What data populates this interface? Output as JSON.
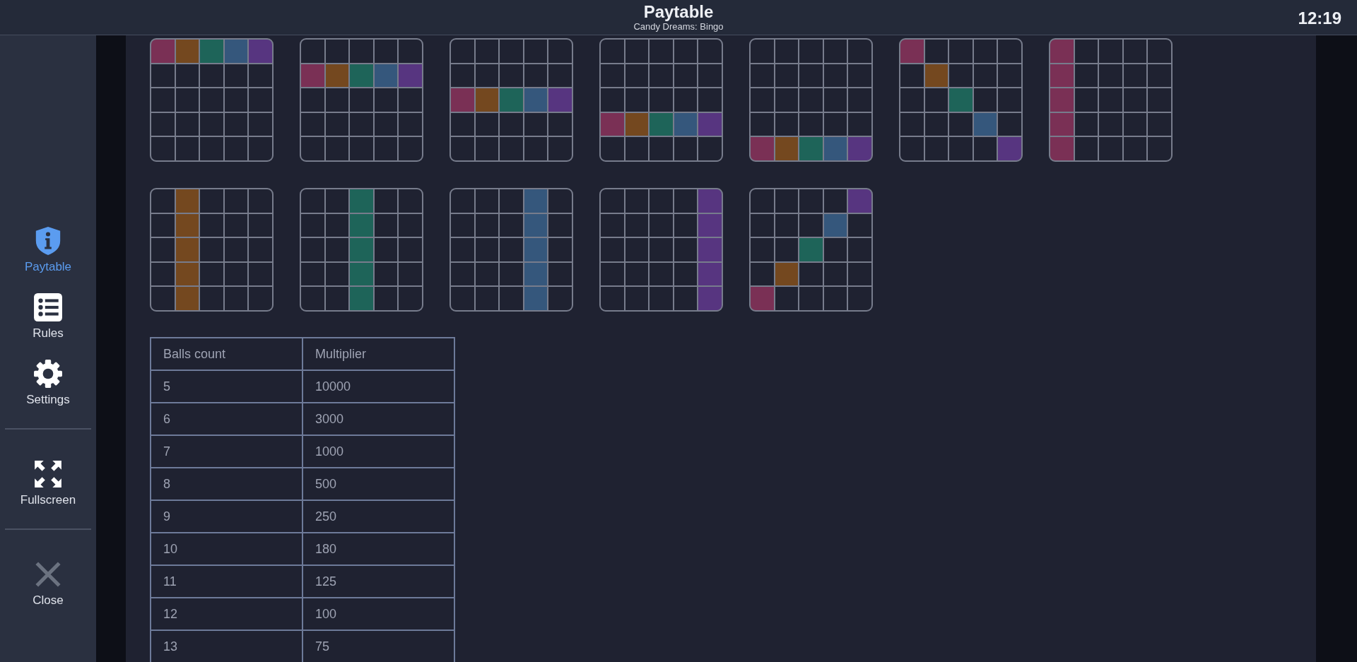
{
  "header": {
    "title": "Paytable",
    "subtitle": "Candy Dreams: Bingo",
    "clock": "12:19"
  },
  "sidebar": {
    "groups": [
      [
        {
          "label": "Paytable",
          "kind": "info",
          "selected": true
        },
        {
          "label": "Rules",
          "kind": "list",
          "selected": false
        },
        {
          "label": "Settings",
          "kind": "gear",
          "selected": false
        }
      ],
      [
        {
          "label": "Fullscreen",
          "kind": "fullscreen",
          "selected": false
        }
      ],
      [
        {
          "label": "Close",
          "kind": "close",
          "selected": false
        }
      ]
    ]
  },
  "line_colors": [
    {
      "color": "#7a3055"
    },
    {
      "color": "#74481f"
    },
    {
      "color": "#1e6459"
    },
    {
      "color": "#35577c"
    },
    {
      "color": "#573580"
    }
  ],
  "patterns": [
    {
      "rows": [
        [
          true,
          true,
          true,
          true,
          true
        ],
        [
          false,
          false,
          false,
          false,
          false
        ],
        [
          false,
          false,
          false,
          false,
          false
        ],
        [
          false,
          false,
          false,
          false,
          false
        ],
        [
          false,
          false,
          false,
          false,
          false
        ]
      ]
    },
    {
      "rows": [
        [
          false,
          false,
          false,
          false,
          false
        ],
        [
          true,
          true,
          true,
          true,
          true
        ],
        [
          false,
          false,
          false,
          false,
          false
        ],
        [
          false,
          false,
          false,
          false,
          false
        ],
        [
          false,
          false,
          false,
          false,
          false
        ]
      ]
    },
    {
      "rows": [
        [
          false,
          false,
          false,
          false,
          false
        ],
        [
          false,
          false,
          false,
          false,
          false
        ],
        [
          true,
          true,
          true,
          true,
          true
        ],
        [
          false,
          false,
          false,
          false,
          false
        ],
        [
          false,
          false,
          false,
          false,
          false
        ]
      ]
    },
    {
      "rows": [
        [
          false,
          false,
          false,
          false,
          false
        ],
        [
          false,
          false,
          false,
          false,
          false
        ],
        [
          false,
          false,
          false,
          false,
          false
        ],
        [
          true,
          true,
          true,
          true,
          true
        ],
        [
          false,
          false,
          false,
          false,
          false
        ]
      ]
    },
    {
      "rows": [
        [
          false,
          false,
          false,
          false,
          false
        ],
        [
          false,
          false,
          false,
          false,
          false
        ],
        [
          false,
          false,
          false,
          false,
          false
        ],
        [
          false,
          false,
          false,
          false,
          false
        ],
        [
          true,
          true,
          true,
          true,
          true
        ]
      ]
    },
    {
      "rows": [
        [
          true,
          false,
          false,
          false,
          false
        ],
        [
          false,
          true,
          false,
          false,
          false
        ],
        [
          false,
          false,
          true,
          false,
          false
        ],
        [
          false,
          false,
          false,
          true,
          false
        ],
        [
          false,
          false,
          false,
          false,
          true
        ]
      ]
    },
    {
      "rows": [
        [
          true,
          false,
          false,
          false,
          false
        ],
        [
          true,
          false,
          false,
          false,
          false
        ],
        [
          true,
          false,
          false,
          false,
          false
        ],
        [
          true,
          false,
          false,
          false,
          false
        ],
        [
          true,
          false,
          false,
          false,
          false
        ]
      ]
    },
    {
      "rows": [
        [
          false,
          true,
          false,
          false,
          false
        ],
        [
          false,
          true,
          false,
          false,
          false
        ],
        [
          false,
          true,
          false,
          false,
          false
        ],
        [
          false,
          true,
          false,
          false,
          false
        ],
        [
          false,
          true,
          false,
          false,
          false
        ]
      ]
    },
    {
      "rows": [
        [
          false,
          false,
          true,
          false,
          false
        ],
        [
          false,
          false,
          true,
          false,
          false
        ],
        [
          false,
          false,
          true,
          false,
          false
        ],
        [
          false,
          false,
          true,
          false,
          false
        ],
        [
          false,
          false,
          true,
          false,
          false
        ]
      ]
    },
    {
      "rows": [
        [
          false,
          false,
          false,
          true,
          false
        ],
        [
          false,
          false,
          false,
          true,
          false
        ],
        [
          false,
          false,
          false,
          true,
          false
        ],
        [
          false,
          false,
          false,
          true,
          false
        ],
        [
          false,
          false,
          false,
          true,
          false
        ]
      ]
    },
    {
      "rows": [
        [
          false,
          false,
          false,
          false,
          true
        ],
        [
          false,
          false,
          false,
          false,
          true
        ],
        [
          false,
          false,
          false,
          false,
          true
        ],
        [
          false,
          false,
          false,
          false,
          true
        ],
        [
          false,
          false,
          false,
          false,
          true
        ]
      ]
    },
    {
      "rows": [
        [
          false,
          false,
          false,
          false,
          true
        ],
        [
          false,
          false,
          false,
          true,
          false
        ],
        [
          false,
          false,
          true,
          false,
          false
        ],
        [
          false,
          true,
          false,
          false,
          false
        ],
        [
          true,
          false,
          false,
          false,
          false
        ]
      ]
    }
  ],
  "table": {
    "columns": [
      "Balls count",
      "Multiplier"
    ],
    "rows": [
      [
        "5",
        "10000"
      ],
      [
        "6",
        "3000"
      ],
      [
        "7",
        "1000"
      ],
      [
        "8",
        "500"
      ],
      [
        "9",
        "250"
      ],
      [
        "10",
        "180"
      ],
      [
        "11",
        "125"
      ],
      [
        "12",
        "100"
      ],
      [
        "13",
        "75"
      ]
    ]
  }
}
